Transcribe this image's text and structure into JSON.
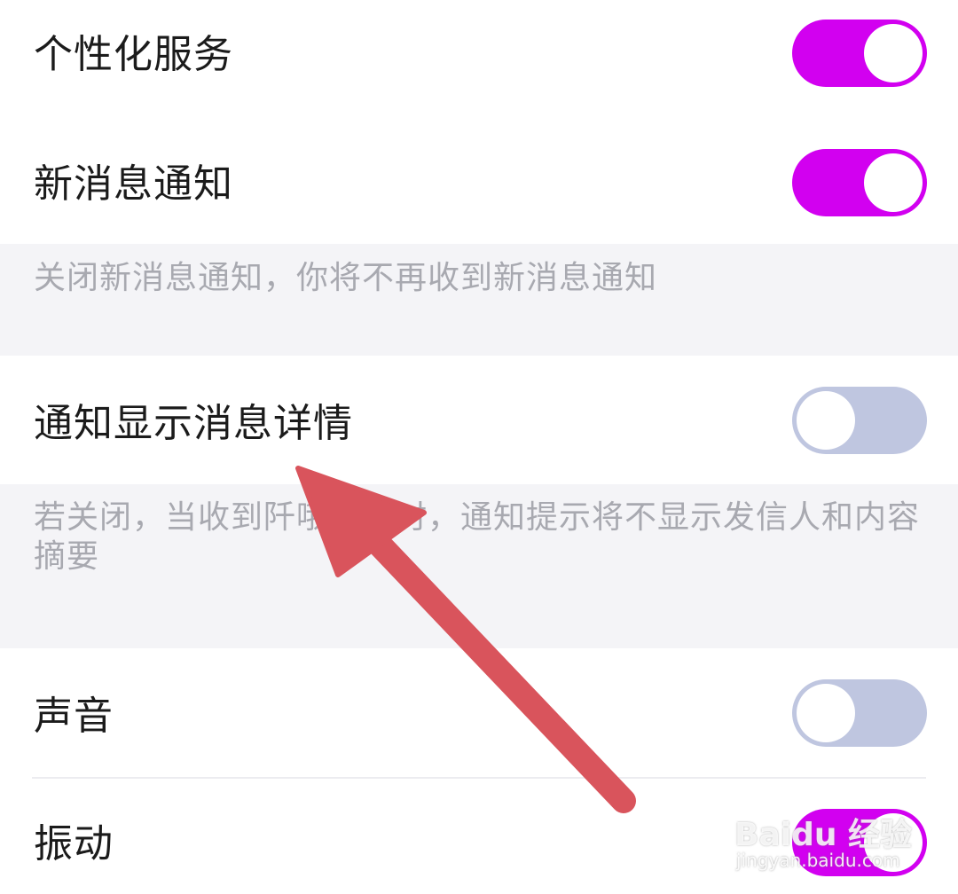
{
  "settings": {
    "personalized_service": {
      "label": "个性化服务",
      "enabled": true
    },
    "new_message_notify": {
      "label": "新消息通知",
      "enabled": true,
      "hint": "关闭新消息通知，你将不再收到新消息通知"
    },
    "show_message_detail": {
      "label": "通知显示消息详情",
      "enabled": false,
      "hint": "若关闭，当收到阡哦消息时，通知提示将不显示发信人和内容摘要"
    },
    "sound": {
      "label": "声音",
      "enabled": false
    },
    "vibrate": {
      "label": "振动",
      "enabled": true
    }
  },
  "colors": {
    "toggle_on": "#d200f0",
    "toggle_off": "#bfc6e0",
    "annotation_arrow": "#d9545c"
  },
  "watermark": {
    "brand": "Baidu 经验",
    "url": "jingyan.baidu.com"
  }
}
